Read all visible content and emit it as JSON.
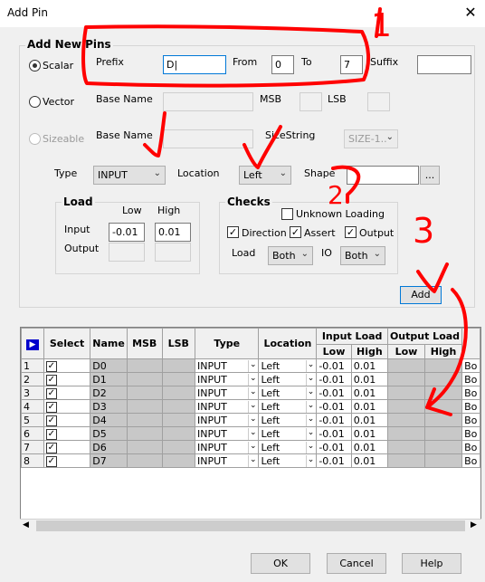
{
  "window": {
    "title": "Add Pin"
  },
  "add_new_pins": {
    "legend": "Add New Pins",
    "scalar": {
      "label": "Scalar",
      "selected": true,
      "prefix_label": "Prefix",
      "prefix_value": "D|",
      "from_label": "From",
      "from_value": "0",
      "to_label": "To",
      "to_value": "7",
      "suffix_label": "Suffix",
      "suffix_value": ""
    },
    "vector": {
      "label": "Vector",
      "base_name_label": "Base Name",
      "msb_label": "MSB",
      "lsb_label": "LSB"
    },
    "sizeable": {
      "label": "Sizeable",
      "base_name_label": "Base Name",
      "sizestring_label": "SizeString",
      "sizestring_value": "SIZE-1.."
    },
    "type_label": "Type",
    "type_value": "INPUT",
    "location_label": "Location",
    "location_value": "Left",
    "shape_label": "Shape",
    "shape_value": "",
    "shape_button": "..."
  },
  "load": {
    "legend": "Load",
    "low_label": "Low",
    "high_label": "High",
    "input_label": "Input",
    "input_low": "-0.01",
    "input_high": "0.01",
    "output_label": "Output"
  },
  "checks": {
    "legend": "Checks",
    "unknown_loading": "Unknown Loading",
    "direction": "Direction",
    "assert": "Assert",
    "output": "Output",
    "load_label": "Load",
    "load_value": "Both",
    "io_label": "IO",
    "io_value": "Both"
  },
  "add_button": "Add",
  "grid": {
    "headers": {
      "select": "Select",
      "name": "Name",
      "msb": "MSB",
      "lsb": "LSB",
      "type": "Type",
      "location": "Location",
      "input_load": "Input Load",
      "output_load": "Output Load",
      "low": "Low",
      "high": "High"
    },
    "rows": [
      {
        "n": "1",
        "name": "D0",
        "type": "INPUT",
        "loc": "Left",
        "low": "-0.01",
        "high": "0.01",
        "extra": "Bo"
      },
      {
        "n": "2",
        "name": "D1",
        "type": "INPUT",
        "loc": "Left",
        "low": "-0.01",
        "high": "0.01",
        "extra": "Bo"
      },
      {
        "n": "3",
        "name": "D2",
        "type": "INPUT",
        "loc": "Left",
        "low": "-0.01",
        "high": "0.01",
        "extra": "Bo"
      },
      {
        "n": "4",
        "name": "D3",
        "type": "INPUT",
        "loc": "Left",
        "low": "-0.01",
        "high": "0.01",
        "extra": "Bo"
      },
      {
        "n": "5",
        "name": "D4",
        "type": "INPUT",
        "loc": "Left",
        "low": "-0.01",
        "high": "0.01",
        "extra": "Bo"
      },
      {
        "n": "6",
        "name": "D5",
        "type": "INPUT",
        "loc": "Left",
        "low": "-0.01",
        "high": "0.01",
        "extra": "Bo"
      },
      {
        "n": "7",
        "name": "D6",
        "type": "INPUT",
        "loc": "Left",
        "low": "-0.01",
        "high": "0.01",
        "extra": "Bo"
      },
      {
        "n": "8",
        "name": "D7",
        "type": "INPUT",
        "loc": "Left",
        "low": "-0.01",
        "high": "0.01",
        "extra": "Bo"
      }
    ]
  },
  "footer": {
    "ok": "OK",
    "cancel": "Cancel",
    "help": "Help"
  },
  "annotations": {
    "mark1": "1",
    "mark2": "2",
    "mark3": "3"
  },
  "colors": {
    "annotation": "#ff0000",
    "grid_gray": "#c8c8c8"
  }
}
